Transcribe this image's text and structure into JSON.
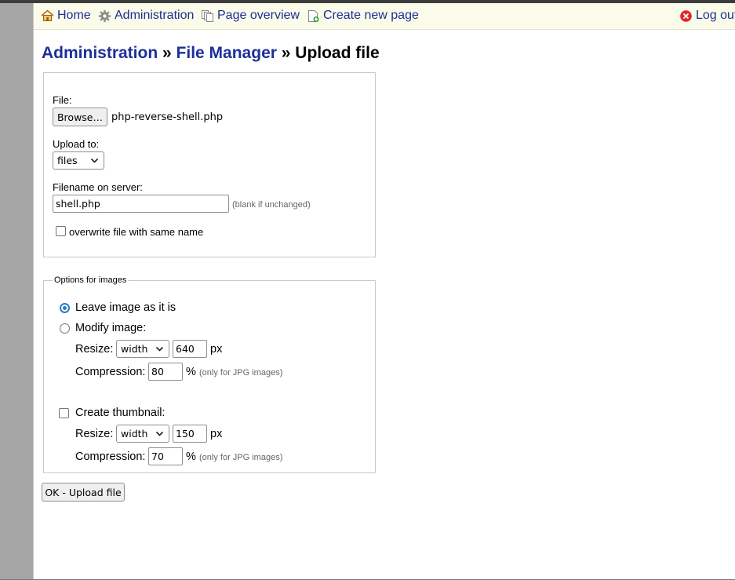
{
  "nav": {
    "home": "Home",
    "administration": "Administration",
    "page_overview": "Page overview",
    "create_new_page": "Create new page",
    "logout": "Log out"
  },
  "heading": {
    "admin_link": "Administration",
    "sep1": "»",
    "file_manager_link": "File Manager",
    "current": "» Upload file"
  },
  "upload": {
    "file_label": "File:",
    "browse_label": "Browse…",
    "selected_file": "php-reverse-shell.php",
    "upload_to_label": "Upload to:",
    "upload_to_value": "files",
    "filename_label": "Filename on server:",
    "filename_value": "shell.php",
    "filename_hint": "(blank if unchanged)",
    "overwrite_label": "overwrite file with same name",
    "overwrite_checked": false
  },
  "image_options": {
    "legend": "Options for images",
    "leave_label": "Leave image as it is",
    "modify_label": "Modify image:",
    "selected_option": "leave",
    "resize_label": "Resize:",
    "resize_mode": "width",
    "resize_value": "640",
    "px_label": "px",
    "compression_label": "Compression:",
    "compression_value": "80",
    "percent_label": "%",
    "jpg_hint": "(only for JPG images)",
    "thumbnail_label": "Create thumbnail:",
    "thumbnail_checked": false,
    "thumb_resize_label": "Resize:",
    "thumb_resize_mode": "width",
    "thumb_resize_value": "150",
    "thumb_px_label": "px",
    "thumb_compression_label": "Compression:",
    "thumb_compression_value": "70",
    "thumb_percent_label": "%",
    "thumb_jpg_hint": "(only for JPG images)"
  },
  "submit_label": "OK - Upload file",
  "colors": {
    "link": "#1d2f9a",
    "navbar_bg": "#fbfbe9",
    "radio_selected": "#2a7ac8",
    "logout_icon": "#e0262a"
  }
}
